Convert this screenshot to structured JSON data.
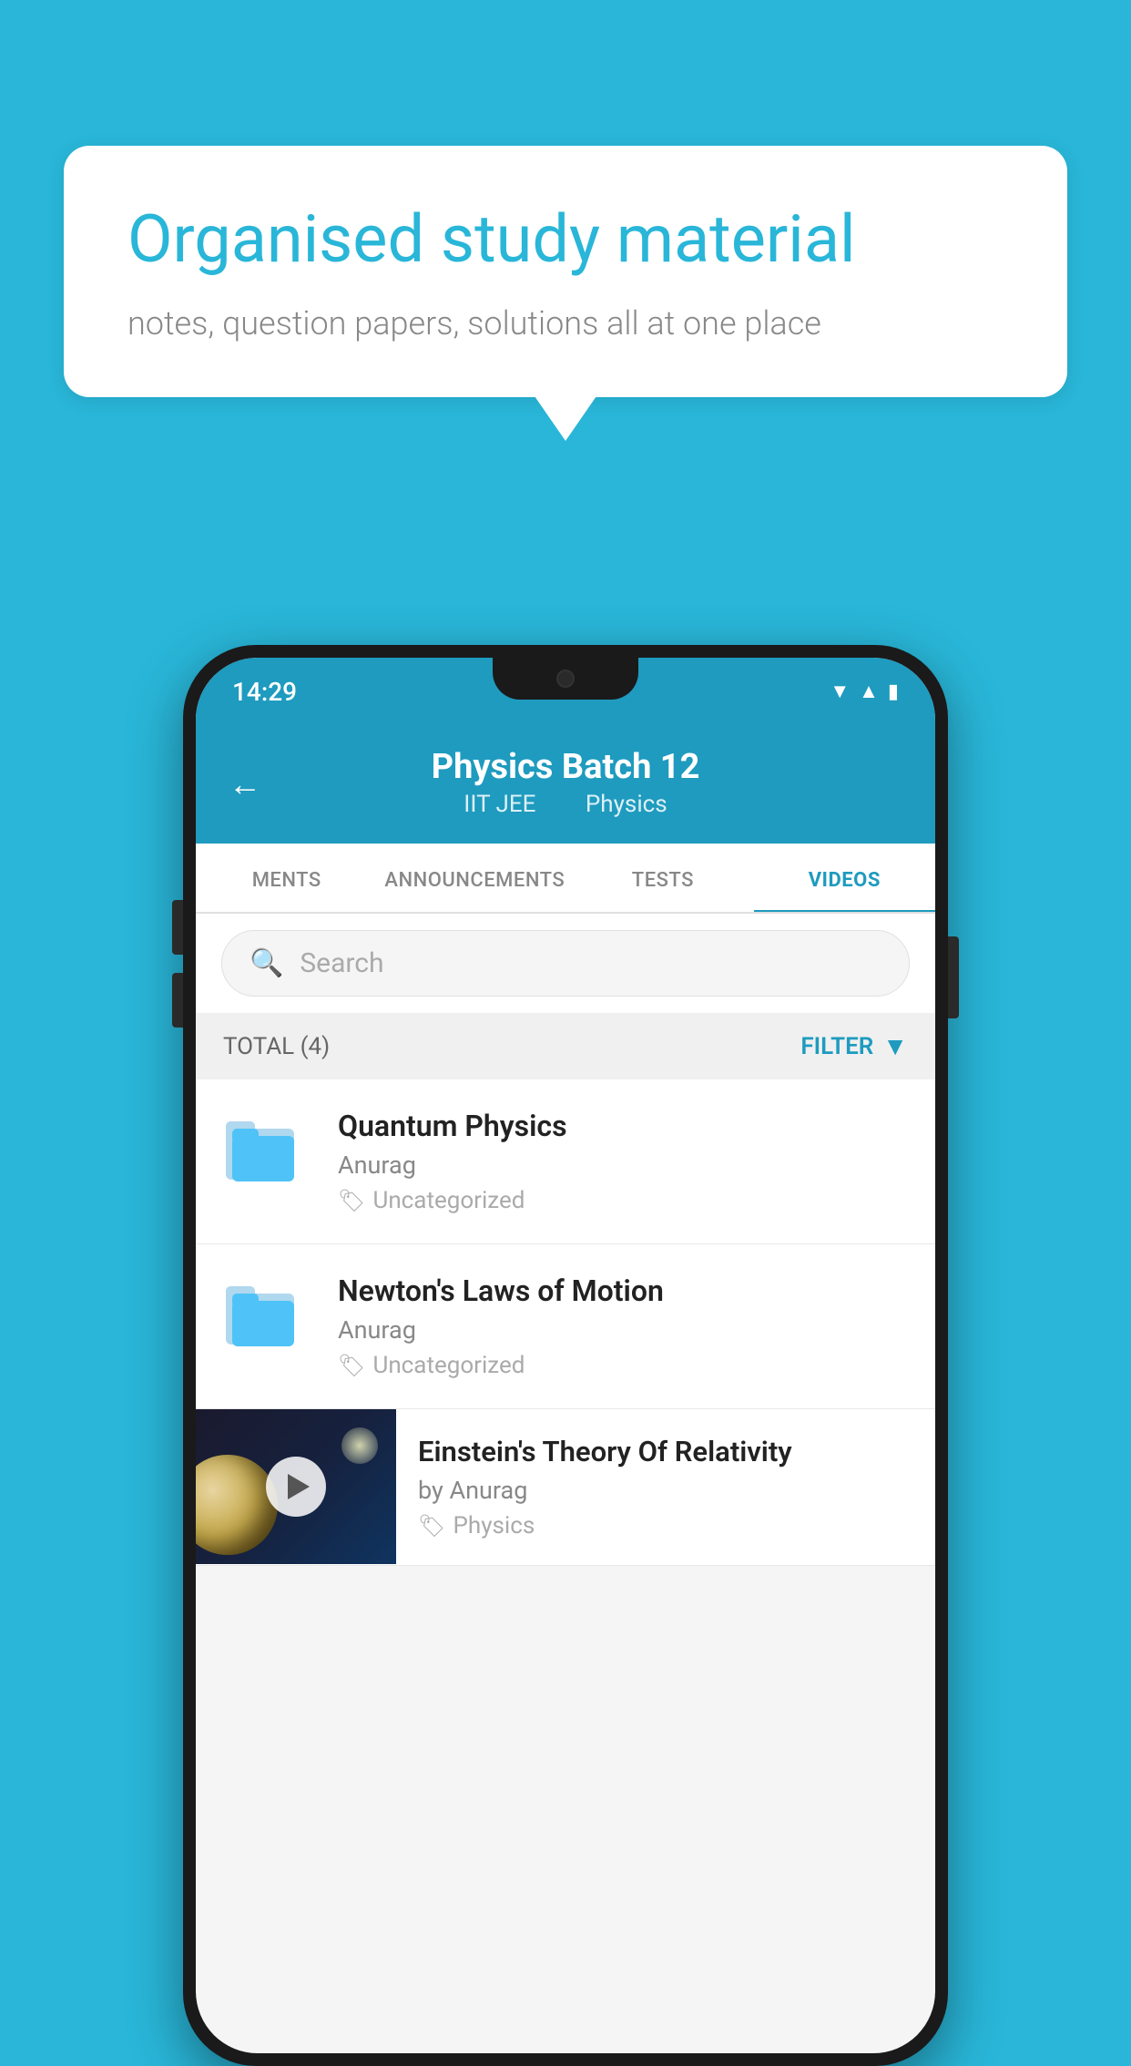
{
  "background": {
    "color": "#29b6d8"
  },
  "speech_bubble": {
    "title": "Organised study material",
    "subtitle": "notes, question papers, solutions all at one place"
  },
  "status_bar": {
    "time": "14:29",
    "signal_icon": "▲",
    "wifi_icon": "▼",
    "battery_icon": "▮"
  },
  "header": {
    "back_label": "←",
    "title": "Physics Batch 12",
    "subtitle_1": "IIT JEE",
    "subtitle_2": "Physics"
  },
  "tabs": [
    {
      "label": "MENTS",
      "active": false
    },
    {
      "label": "ANNOUNCEMENTS",
      "active": false
    },
    {
      "label": "TESTS",
      "active": false
    },
    {
      "label": "VIDEOS",
      "active": true
    }
  ],
  "search": {
    "placeholder": "Search"
  },
  "filter_bar": {
    "total_label": "TOTAL (4)",
    "filter_label": "FILTER"
  },
  "videos": [
    {
      "id": 1,
      "title": "Quantum Physics",
      "author": "Anurag",
      "tag": "Uncategorized",
      "has_thumbnail": false
    },
    {
      "id": 2,
      "title": "Newton's Laws of Motion",
      "author": "Anurag",
      "tag": "Uncategorized",
      "has_thumbnail": false
    },
    {
      "id": 3,
      "title": "Einstein's Theory Of Relativity",
      "author": "by Anurag",
      "tag": "Physics",
      "has_thumbnail": true
    }
  ]
}
